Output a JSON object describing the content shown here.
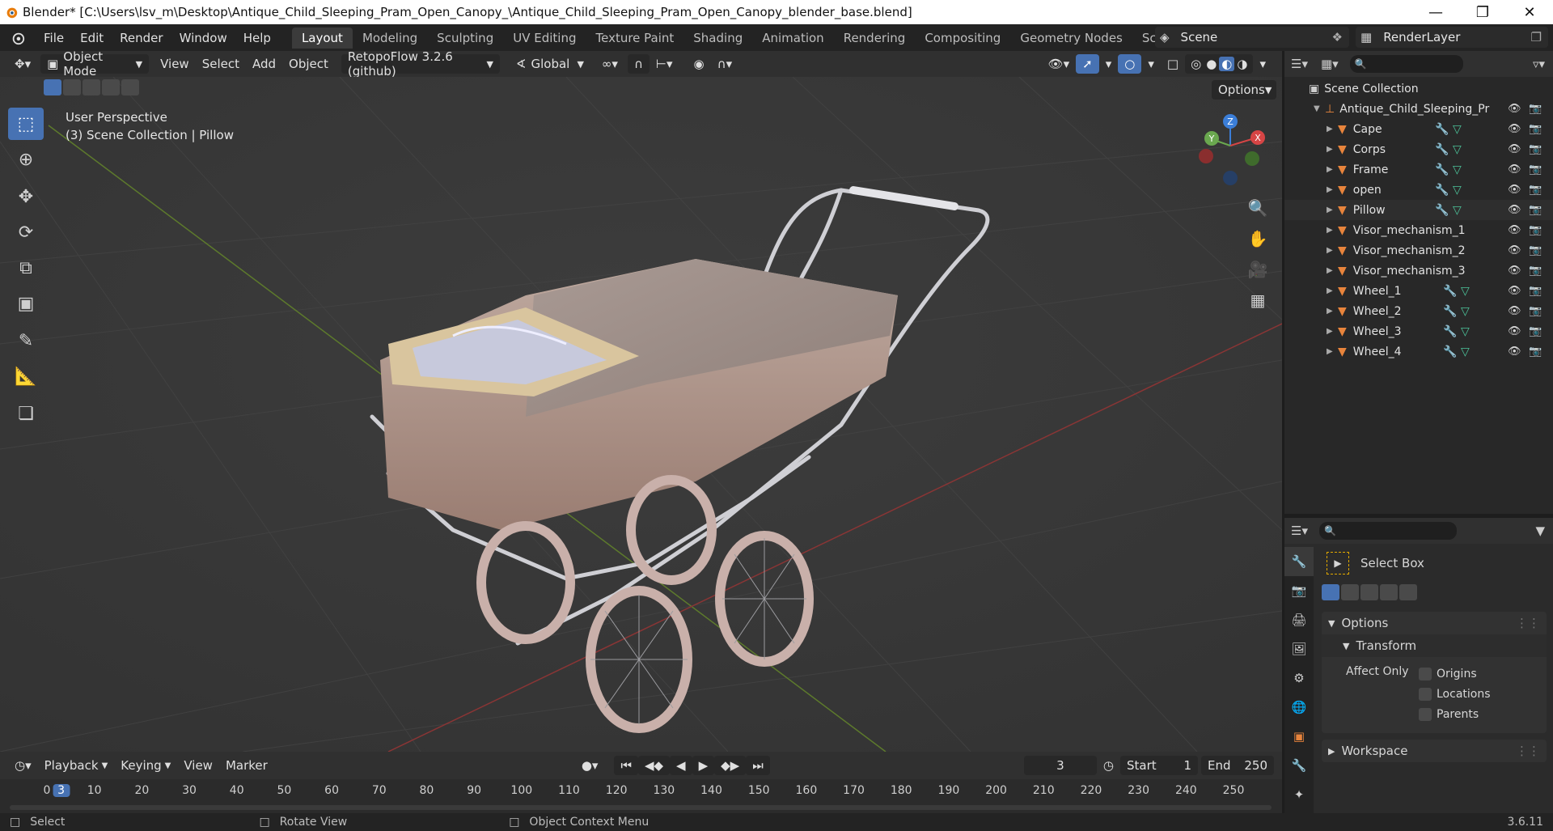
{
  "window": {
    "title": "Blender* [C:\\Users\\lsv_m\\Desktop\\Antique_Child_Sleeping_Pram_Open_Canopy_\\Antique_Child_Sleeping_Pram_Open_Canopy_blender_base.blend]"
  },
  "menu": [
    "File",
    "Edit",
    "Render",
    "Window",
    "Help"
  ],
  "workspaces": [
    "Layout",
    "Modeling",
    "Sculpting",
    "UV Editing",
    "Texture Paint",
    "Shading",
    "Animation",
    "Rendering",
    "Compositing",
    "Geometry Nodes",
    "Scripting",
    "+"
  ],
  "scene": {
    "name": "Scene",
    "view_layer": "RenderLayer"
  },
  "viewport_header": {
    "mode": "Object Mode",
    "view": "View",
    "select": "Select",
    "add": "Add",
    "object": "Object",
    "addon": "RetopoFlow 3.2.6 (github)",
    "orientation": "Global",
    "options": "Options"
  },
  "viewport": {
    "perspective": "User Perspective",
    "collection_info": "(3) Scene Collection | Pillow",
    "gizmo": {
      "z": "Z",
      "y": "Y",
      "x": "X"
    }
  },
  "outliner": {
    "root": "Scene Collection",
    "collection": "Antique_Child_Sleeping_Pr",
    "items": [
      {
        "name": "Cape",
        "mods": true
      },
      {
        "name": "Corps",
        "mods": true
      },
      {
        "name": "Frame",
        "mods": true
      },
      {
        "name": "open",
        "mods": true
      },
      {
        "name": "Pillow",
        "mods": true
      },
      {
        "name": "Visor_mechanism_1",
        "mods": false
      },
      {
        "name": "Visor_mechanism_2",
        "mods": false
      },
      {
        "name": "Visor_mechanism_3",
        "mods": false
      },
      {
        "name": "Wheel_1",
        "mods": true
      },
      {
        "name": "Wheel_2",
        "mods": true
      },
      {
        "name": "Wheel_3",
        "mods": true
      },
      {
        "name": "Wheel_4",
        "mods": true
      }
    ]
  },
  "properties": {
    "tool": "Select Box",
    "options": "Options",
    "transform": "Transform",
    "affect_only": "Affect Only",
    "checks": [
      "Origins",
      "Locations",
      "Parents"
    ],
    "workspace": "Workspace"
  },
  "timeline": {
    "playback": "Playback",
    "keying": "Keying",
    "view": "View",
    "marker": "Marker",
    "current_frame": "3",
    "start_label": "Start",
    "start": "1",
    "end_label": "End",
    "end": "250",
    "ticks": [
      "0",
      "10",
      "20",
      "30",
      "40",
      "50",
      "60",
      "70",
      "80",
      "90",
      "100",
      "110",
      "120",
      "130",
      "140",
      "150",
      "160",
      "170",
      "180",
      "190",
      "200",
      "210",
      "220",
      "230",
      "240",
      "250"
    ]
  },
  "status": {
    "select": "Select",
    "rotate": "Rotate View",
    "context": "Object Context Menu",
    "version": "3.6.11"
  },
  "colors": {
    "accent": "#4772b3",
    "object_orange": "#e8843c",
    "mesh_green": "#4cc39a",
    "modifier_blue": "#6a8fd6"
  }
}
